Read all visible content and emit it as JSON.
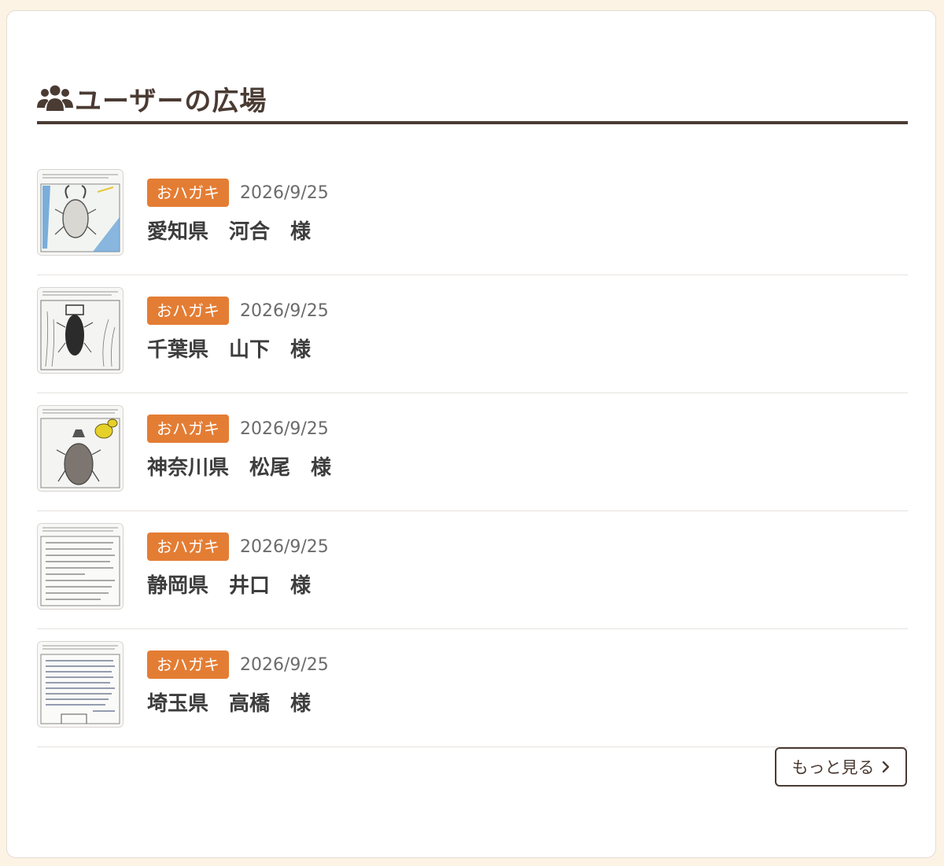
{
  "section": {
    "title": "ユーザーの広場",
    "icon": "users-icon"
  },
  "posts": [
    {
      "badge": "おハガキ",
      "date": "2026/9/25",
      "name": "愛知県　河合　様",
      "thumbnail": "stag-beetle-drawing"
    },
    {
      "badge": "おハガキ",
      "date": "2026/9/25",
      "name": "千葉県　山下　様",
      "thumbnail": "beetle-sketch-drawing"
    },
    {
      "badge": "おハガキ",
      "date": "2026/9/25",
      "name": "神奈川県　松尾　様",
      "thumbnail": "rhinoceros-beetle-drawing"
    },
    {
      "badge": "おハガキ",
      "date": "2026/9/25",
      "name": "静岡県　井口　様",
      "thumbnail": "handwritten-letter"
    },
    {
      "badge": "おハガキ",
      "date": "2026/9/25",
      "name": "埼玉県　高橋　様",
      "thumbnail": "handwritten-letter"
    }
  ],
  "more_button": {
    "label": "もっと見る",
    "icon": "chevron-right-icon"
  },
  "colors": {
    "accent": "#e47d34",
    "heading": "#4a3b33",
    "background": "#fdf3e4"
  }
}
